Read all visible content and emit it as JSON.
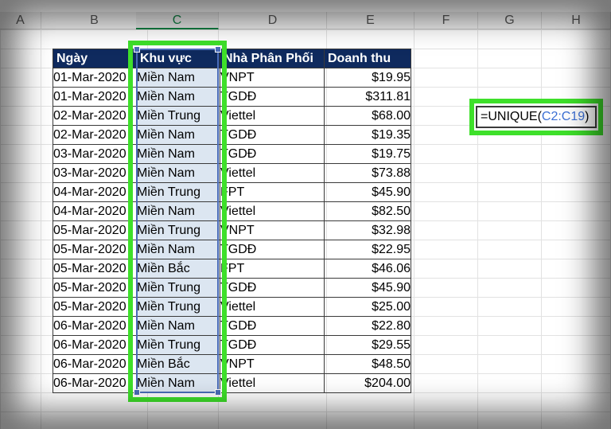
{
  "columns": [
    "A",
    "B",
    "C",
    "D",
    "E",
    "F",
    "G",
    "H"
  ],
  "headers": [
    "Ngày",
    "Khu vực",
    "Nhà Phân Phối",
    "Doanh thu"
  ],
  "rows": [
    [
      "01-Mar-2020",
      "Miền Nam",
      "VNPT",
      "$19.95"
    ],
    [
      "01-Mar-2020",
      "Miền Nam",
      "TGDĐ",
      "$311.81"
    ],
    [
      "02-Mar-2020",
      "Miền Trung",
      "Viettel",
      "$68.00"
    ],
    [
      "02-Mar-2020",
      "Miền Nam",
      "TGDĐ",
      "$19.35"
    ],
    [
      "03-Mar-2020",
      "Miền Nam",
      "TGDĐ",
      "$19.75"
    ],
    [
      "03-Mar-2020",
      "Miền Nam",
      "Viettel",
      "$73.88"
    ],
    [
      "04-Mar-2020",
      "Miền Trung",
      "FPT",
      "$45.90"
    ],
    [
      "04-Mar-2020",
      "Miền Nam",
      "Viettel",
      "$82.50"
    ],
    [
      "05-Mar-2020",
      "Miền Trung",
      "VNPT",
      "$32.98"
    ],
    [
      "05-Mar-2020",
      "Miền Nam",
      "TGDĐ",
      "$22.95"
    ],
    [
      "05-Mar-2020",
      "Miền Bắc",
      "FPT",
      "$46.06"
    ],
    [
      "05-Mar-2020",
      "Miền Trung",
      "TGDĐ",
      "$45.90"
    ],
    [
      "05-Mar-2020",
      "Miền Trung",
      "Viettel",
      "$25.00"
    ],
    [
      "06-Mar-2020",
      "Miền Nam",
      "TGDĐ",
      "$22.80"
    ],
    [
      "06-Mar-2020",
      "Miền Trung",
      "TGDĐ",
      "$29.55"
    ],
    [
      "06-Mar-2020",
      "Miền Bắc",
      "VNPT",
      "$48.50"
    ],
    [
      "06-Mar-2020",
      "Miền Nam",
      "Viettel",
      "$204.00"
    ]
  ],
  "formula": {
    "prefix": "=UNIQUE(",
    "ref": "C2:C19",
    "suffix": ")"
  },
  "colors": {
    "highlight": "#3ee02a",
    "header_fill": "#0f2a5e",
    "selection": "#4a6cb8",
    "selected_col_header": "#107c41"
  }
}
